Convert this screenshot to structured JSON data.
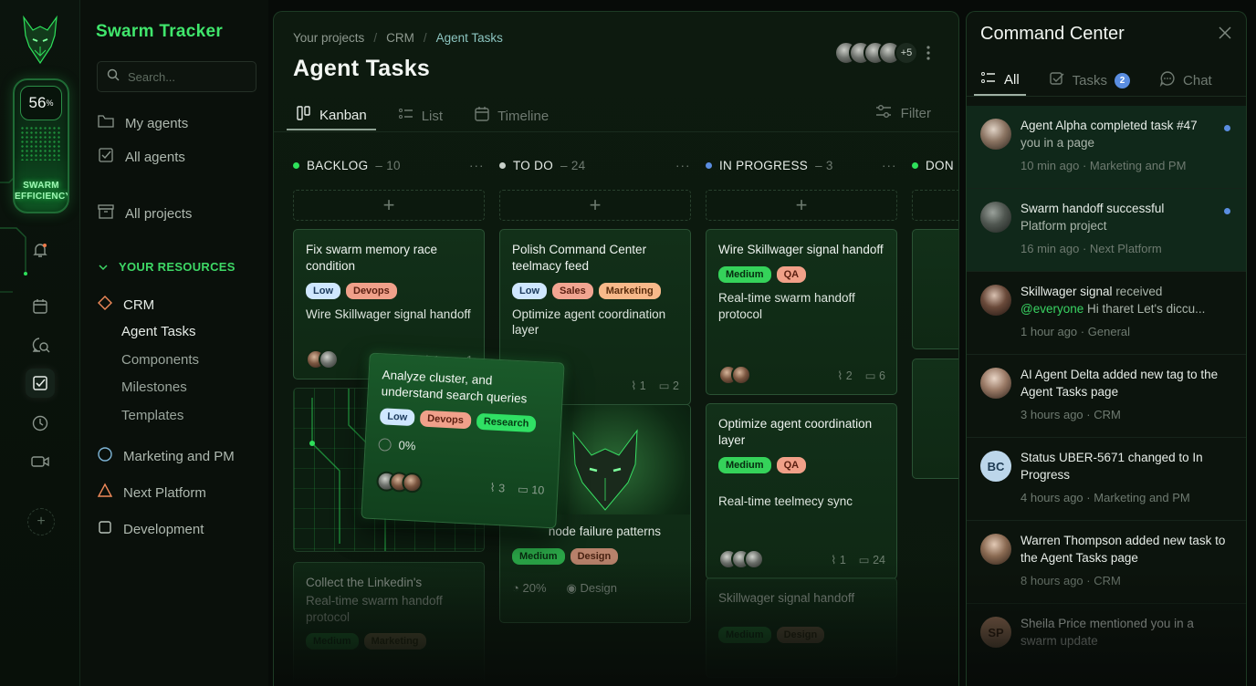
{
  "app": {
    "name": "Swarm Tracker",
    "efficiency": {
      "value": "56",
      "unit": "%",
      "label_line1": "SWARM",
      "label_line2": "EFFICIENCY"
    }
  },
  "rail": {
    "icons": [
      "bell-icon",
      "calendar-icon",
      "search-chat-icon",
      "checkbox-icon",
      "clock-icon",
      "video-icon",
      "plus-icon"
    ],
    "add_label": "+"
  },
  "sidebar": {
    "search_placeholder": "Search...",
    "top_items": [
      {
        "label": "My agents",
        "icon": "folder-icon"
      },
      {
        "label": "All agents",
        "icon": "checkbox-icon"
      },
      {
        "label": "All projects",
        "icon": "archive-icon"
      }
    ],
    "section_label": "YOUR RESOURCES",
    "projects": [
      {
        "label": "CRM",
        "icon": "diamond-icon"
      },
      {
        "label": "Marketing and PM",
        "icon": "circle-icon"
      },
      {
        "label": "Next Platform",
        "icon": "triangle-icon"
      },
      {
        "label": "Development",
        "icon": "square-icon"
      }
    ],
    "crm_children": [
      "Agent Tasks",
      "Components",
      "Milestones",
      "Templates"
    ]
  },
  "header": {
    "breadcrumb": [
      "Your projects",
      "CRM",
      "Agent Tasks"
    ],
    "separator": "/",
    "title": "Agent Tasks",
    "more_members": "+5",
    "views": [
      "Kanban",
      "List",
      "Timeline"
    ],
    "filter_label": "Filter"
  },
  "columns": [
    {
      "name": "BACKLOG",
      "count": "– 10",
      "color": "#2ee05a"
    },
    {
      "name": "TO DO",
      "count": "– 24",
      "color": "#c8d0c9"
    },
    {
      "name": "IN PROGRESS",
      "count": "– 3",
      "color": "#5a8de0"
    },
    {
      "name": "DON",
      "count": "",
      "color": "#2ee05a"
    }
  ],
  "column_more": "···",
  "add_symbol": "+",
  "cards": {
    "backlog_1": {
      "title": "Fix swarm memory race condition",
      "tags": [
        "Low",
        "Devops"
      ],
      "desc": "Wire Skillwager signal handoff",
      "files": "1",
      "comments": "1"
    },
    "backlog_3": {
      "title": "Collect the Linkedin's",
      "desc": "Real-time swarm handoff protocol",
      "tags": [
        "Medium",
        "Marketing"
      ]
    },
    "todo_1": {
      "title": "Polish Command Center teelmacy feed",
      "tags": [
        "Low",
        "Sales",
        "Marketing"
      ],
      "desc": "Optimize agent coordination layer",
      "files": "1",
      "comments": "2"
    },
    "todo_2": {
      "desc": "node failure patterns",
      "tags": [
        "Medium",
        "Design"
      ],
      "progress": "20%",
      "link": "Design"
    },
    "prog_1": {
      "title": "Wire Skillwager signal handoff",
      "tags": [
        "Medium",
        "QA"
      ],
      "desc": "Real-time swarm handoff protocol",
      "files": "2",
      "comments": "6"
    },
    "prog_2": {
      "title": "Optimize agent coordination layer",
      "tags": [
        "Medium",
        "QA"
      ],
      "desc": "Real-time teelmecy sync",
      "files": "1",
      "comments": "24"
    },
    "prog_3": {
      "title": "Skillwager signal handoff",
      "tags": [
        "Medium",
        "Design"
      ]
    },
    "floating": {
      "title": "Analyze cluster, and understand search queries",
      "tags": [
        "Low",
        "Devops",
        "Research"
      ],
      "progress": "0%",
      "files": "3",
      "comments": "10"
    }
  },
  "command_center": {
    "title": "Command Center",
    "tabs": [
      {
        "label": "All"
      },
      {
        "label": "Tasks",
        "badge": "2"
      },
      {
        "label": "Chat"
      }
    ],
    "feed": [
      {
        "text": "Agent Alpha completed task #47",
        "sub": "you in a page",
        "time": "10 min ago",
        "project": "Marketing and PM",
        "unread": true
      },
      {
        "text": "Swarm handoff successful",
        "sub": "Platform project",
        "time": "16 min ago",
        "project": "Next Platform",
        "unread": true
      },
      {
        "text": "Skillwager signal",
        "text2": "received",
        "mention": "@everyone",
        "sub": "Hi tharet Let's diccu...",
        "time": "1 hour ago",
        "project": "General"
      },
      {
        "text": "AI Agent Delta added new tag to the Agent Tasks page",
        "time": "3 hours ago",
        "project": "CRM"
      },
      {
        "initials": "BC",
        "text": "Status UBER-5671 changed to In Progress",
        "time": "4 hours ago",
        "project": "Marketing and PM"
      },
      {
        "text": "Warren Thompson added new task to the Agent Tasks page",
        "time": "8 hours ago",
        "project": "CRM"
      },
      {
        "initials": "SP",
        "text": "Sheila Price mentioned you in a swarm update"
      }
    ],
    "separator": "·"
  }
}
